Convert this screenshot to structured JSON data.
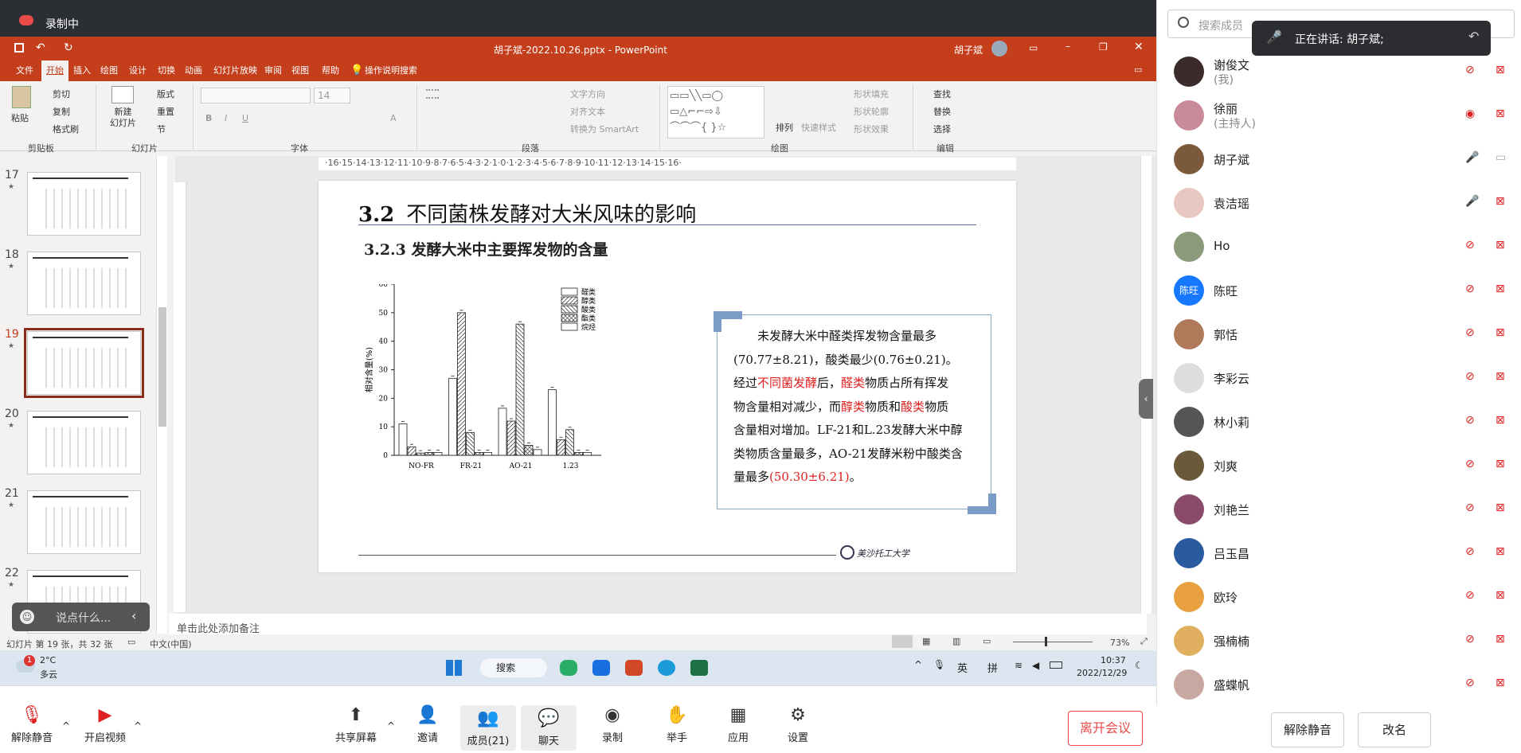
{
  "recording": {
    "label": "录制中"
  },
  "ppt": {
    "window_title": "胡子斌-2022.10.26.pptx - PowerPoint",
    "user": "胡子斌",
    "tabs": [
      "文件",
      "开始",
      "插入",
      "绘图",
      "设计",
      "切换",
      "动画",
      "幻灯片放映",
      "审阅",
      "视图",
      "帮助",
      "操作说明搜索"
    ],
    "ribbon": {
      "clipboard": {
        "paste": "粘贴",
        "cut": "剪切",
        "copy": "复制",
        "format_painter": "格式刷",
        "group": "剪贴板"
      },
      "slides": {
        "new_slide": "新建\n幻灯片",
        "layout": "版式",
        "reset": "重置",
        "section": "节",
        "group": "幻灯片"
      },
      "font": {
        "size": "14",
        "group": "字体"
      },
      "paragraph": {
        "text_direction": "文字方向",
        "align_text": "对齐文本",
        "smartart": "转换为 SmartArt",
        "group": "段落"
      },
      "drawing": {
        "arrange": "排列",
        "quick_styles": "快速样式",
        "shape_fill": "形状填充",
        "shape_outline": "形状轮廓",
        "shape_effects": "形状效果",
        "group": "绘图"
      },
      "editing": {
        "find": "查找",
        "replace": "替换",
        "select": "选择",
        "group": "编辑"
      }
    },
    "ruler": "·16·15·14·13·12·11·10·9·8·7·6·5·4·3·2·1·0·1·2·3·4·5·6·7·8·9·10·11·12·13·14·15·16·",
    "thumbnails": [
      {
        "num": "17"
      },
      {
        "num": "18"
      },
      {
        "num": "19"
      },
      {
        "num": "20"
      },
      {
        "num": "21"
      },
      {
        "num": "22"
      }
    ],
    "slide": {
      "title_num": "3.2",
      "title": "不同菌株发酵对大米风味的影响",
      "subtitle": "3.2.3 发酵大米中主要挥发物的含量",
      "textbox": [
        [
          {
            "t": "未发酵大米中醛类挥发物含量最多"
          }
        ],
        [
          {
            "t": "(70.77±8.21)，酸类最少(0.76±0.21)。"
          }
        ],
        [
          {
            "t": "经过"
          },
          {
            "t": "不同菌发酵",
            "red": true
          },
          {
            "t": "后，"
          },
          {
            "t": "醛类",
            "red": true
          },
          {
            "t": "物质占所有挥发"
          }
        ],
        [
          {
            "t": "物含量相对减少，而"
          },
          {
            "t": "醇类",
            "red": true
          },
          {
            "t": "物质和"
          },
          {
            "t": "酸类",
            "red": true
          },
          {
            "t": "物质"
          }
        ],
        [
          {
            "t": "含量相对增加。LF-21和L.23发酵大米中醇"
          }
        ],
        [
          {
            "t": "类物质含量最多，AO-21发酵米粉中酸类含"
          }
        ],
        [
          {
            "t": "量最多"
          },
          {
            "t": "(50.30±6.21)",
            "red": true
          },
          {
            "t": "。"
          }
        ]
      ],
      "logo_text": "美沙托工大学"
    },
    "notes_placeholder": "单击此处添加备注",
    "chat_placeholder": "说点什么...",
    "status": {
      "slide_info": "幻灯片 第 19 张，共 32 张",
      "language": "中文(中国)",
      "zoom": "73%"
    },
    "taskbar": {
      "weather_temp": "2°C",
      "weather_desc": "多云",
      "weather_badge": "1",
      "search": "搜索",
      "ime_lang": "英",
      "ime_mode": "拼",
      "time": "10:37",
      "date": "2022/12/29"
    }
  },
  "chart_data": {
    "type": "bar",
    "categories": [
      "NO-FR",
      "FR-21",
      "AO-21",
      "1.23"
    ],
    "series": [
      {
        "name": "醛类",
        "values": [
          11,
          27,
          16.5,
          23
        ]
      },
      {
        "name": "醇类",
        "values": [
          3,
          50,
          12,
          5.5
        ]
      },
      {
        "name": "酸类",
        "values": [
          0.8,
          8,
          46,
          9
        ]
      },
      {
        "name": "酯类",
        "values": [
          1,
          1,
          3.5,
          1
        ]
      },
      {
        "name": "烷烃",
        "values": [
          1,
          1,
          2,
          1
        ]
      }
    ],
    "ylabel": "相对含量(%)",
    "ylim": [
      0,
      60
    ],
    "yticks": [
      "0",
      "10",
      "20",
      "30",
      "40",
      "50",
      "60"
    ],
    "legend": "top-right"
  },
  "toolbar": [
    {
      "label": "解除静音",
      "icon": "mic-muted-icon"
    },
    {
      "label": "开启视频",
      "icon": "video-off-icon"
    },
    {
      "label": "共享屏幕",
      "icon": "share-screen-icon"
    },
    {
      "label": "邀请",
      "icon": "invite-icon"
    },
    {
      "label": "成员(21)",
      "icon": "members-icon"
    },
    {
      "label": "聊天",
      "icon": "chat-icon"
    },
    {
      "label": "录制",
      "icon": "record-icon"
    },
    {
      "label": "举手",
      "icon": "raise-hand-icon"
    },
    {
      "label": "应用",
      "icon": "apps-icon"
    },
    {
      "label": "设置",
      "icon": "settings-icon"
    }
  ],
  "leave_button": "离开会议",
  "panel": {
    "search_placeholder": "搜索成员",
    "speaking": "正在讲话: 胡子斌;",
    "unmute_all": "解除静音",
    "rename": "改名",
    "members": [
      {
        "name": "谢俊文",
        "sub": "(我)",
        "color": "#3b2b2b",
        "mic": "muted",
        "cam": "off"
      },
      {
        "name": "徐丽",
        "sub": "(主持人)",
        "color": "#c98a9a",
        "mic": "host",
        "cam": "off"
      },
      {
        "name": "胡子斌",
        "sub": "",
        "color": "#7a5a3a",
        "mic": "active",
        "cam": "screen"
      },
      {
        "name": "袁洁瑶",
        "sub": "",
        "color": "#e8c8c0",
        "mic": "on",
        "cam": "off"
      },
      {
        "name": "Ho",
        "sub": "",
        "color": "#8a9a7a",
        "mic": "muted",
        "cam": "off"
      },
      {
        "name": "陈旺",
        "sub": "",
        "color": "#1677ff",
        "text": "陈旺",
        "mic": "muted",
        "cam": "off"
      },
      {
        "name": "郭恬",
        "sub": "",
        "color": "#b07a5a",
        "mic": "muted",
        "cam": "off"
      },
      {
        "name": "李彩云",
        "sub": "",
        "color": "#ddd",
        "mic": "muted",
        "cam": "off"
      },
      {
        "name": "林小莉",
        "sub": "",
        "color": "#555",
        "mic": "muted",
        "cam": "off"
      },
      {
        "name": "刘爽",
        "sub": "",
        "color": "#6a5a3a",
        "mic": "muted",
        "cam": "off"
      },
      {
        "name": "刘艳兰",
        "sub": "",
        "color": "#8a4a6a",
        "mic": "muted",
        "cam": "off"
      },
      {
        "name": "吕玉昌",
        "sub": "",
        "color": "#2a5aa0",
        "mic": "muted",
        "cam": "off"
      },
      {
        "name": "欧玲",
        "sub": "",
        "color": "#e8a040",
        "mic": "muted",
        "cam": "off"
      },
      {
        "name": "强楠楠",
        "sub": "",
        "color": "#e0b060",
        "mic": "muted",
        "cam": "off"
      },
      {
        "name": "盛蝶帆",
        "sub": "",
        "color": "#c8a8a0",
        "mic": "muted",
        "cam": "off"
      }
    ]
  }
}
